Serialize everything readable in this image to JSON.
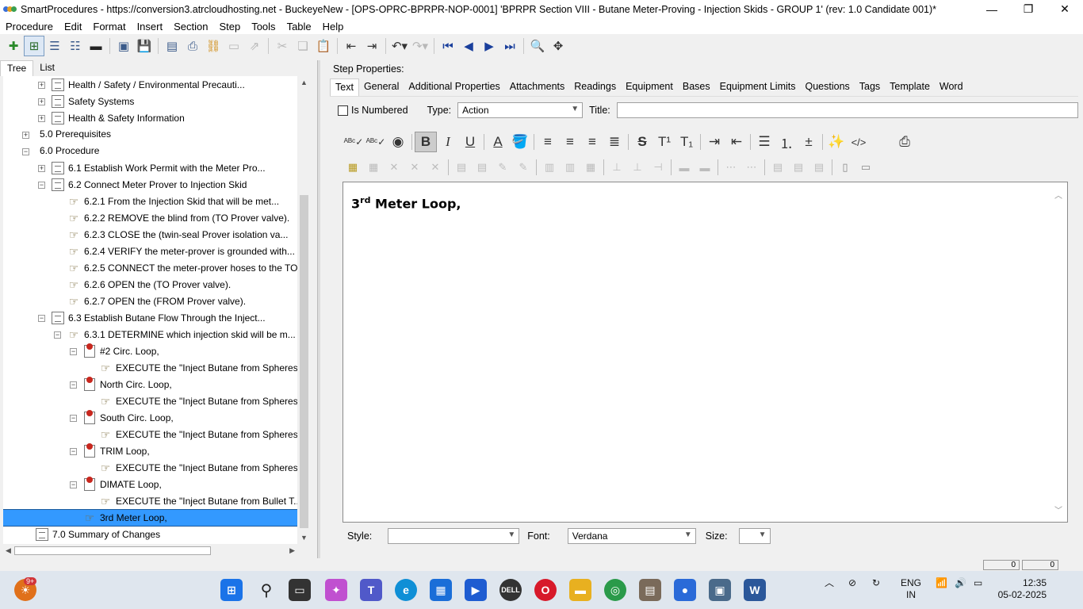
{
  "window": {
    "title": "SmartProcedures - https://conversion3.atrcloudhosting.net - BuckeyeNew - [OPS-OPRC-BPRPR-NOP-0001] 'BPRPR Section VIII - Butane Meter-Proving - Injection Skids - GROUP 1' (rev: 1.0 Candidate 001)*",
    "minimize": "—",
    "restore": "❐",
    "close": "✕"
  },
  "menu": [
    "Procedure",
    "Edit",
    "Format",
    "Insert",
    "Section",
    "Step",
    "Tools",
    "Table",
    "Help"
  ],
  "left_tabs": [
    "Tree",
    "List"
  ],
  "tree": [
    {
      "label": "Health / Safety / Environmental Precauti...",
      "indent": 2,
      "icon": "doc",
      "expander": "+"
    },
    {
      "label": "Safety Systems",
      "indent": 2,
      "icon": "doc",
      "expander": "+"
    },
    {
      "label": "Health & Safety Information",
      "indent": 2,
      "icon": "doc",
      "expander": "+"
    },
    {
      "label": "5.0 Prerequisites",
      "indent": 1,
      "icon": "none",
      "expander": "+"
    },
    {
      "label": "6.0 Procedure",
      "indent": 1,
      "icon": "none",
      "expander": "−"
    },
    {
      "label": "6.1 Establish Work Permit with the Meter Pro...",
      "indent": 2,
      "icon": "doc",
      "expander": "+"
    },
    {
      "label": "6.2 Connect Meter Prover to Injection Skid",
      "indent": 2,
      "icon": "doc",
      "expander": "−"
    },
    {
      "label": "6.2.1 From the Injection Skid that will be met...",
      "indent": 3,
      "icon": "hand",
      "expander": ""
    },
    {
      "label": "6.2.2 REMOVE the blind from (TO Prover valve).",
      "indent": 3,
      "icon": "hand",
      "expander": ""
    },
    {
      "label": "6.2.3 CLOSE the (twin-seal Prover isolation va...",
      "indent": 3,
      "icon": "hand",
      "expander": ""
    },
    {
      "label": "6.2.4 VERIFY the meter-prover is grounded with...",
      "indent": 3,
      "icon": "hand",
      "expander": ""
    },
    {
      "label": "6.2.5 CONNECT the meter-prover hoses to the TO...",
      "indent": 3,
      "icon": "hand",
      "expander": ""
    },
    {
      "label": "6.2.6 OPEN the (TO Prover valve).",
      "indent": 3,
      "icon": "hand",
      "expander": ""
    },
    {
      "label": "6.2.7 OPEN the (FROM Prover valve).",
      "indent": 3,
      "icon": "hand",
      "expander": ""
    },
    {
      "label": "6.3 Establish Butane Flow Through the Inject...",
      "indent": 2,
      "icon": "doc",
      "expander": "−"
    },
    {
      "label": "6.3.1 DETERMINE which injection skid will be m...",
      "indent": 3,
      "icon": "hand",
      "expander": "−"
    },
    {
      "label": "#2 Circ. Loop,",
      "indent": 4,
      "icon": "pin",
      "expander": "−"
    },
    {
      "label": "EXECUTE the \"Inject Butane from Spheres...",
      "indent": 5,
      "icon": "hand",
      "expander": ""
    },
    {
      "label": "North Circ. Loop,",
      "indent": 4,
      "icon": "pin",
      "expander": "−"
    },
    {
      "label": "EXECUTE the \"Inject Butane from Spheres...",
      "indent": 5,
      "icon": "hand",
      "expander": ""
    },
    {
      "label": "South Circ. Loop,",
      "indent": 4,
      "icon": "pin",
      "expander": "−"
    },
    {
      "label": "EXECUTE the \"Inject Butane from Spheres...",
      "indent": 5,
      "icon": "hand",
      "expander": ""
    },
    {
      "label": "TRIM Loop,",
      "indent": 4,
      "icon": "pin",
      "expander": "−"
    },
    {
      "label": "EXECUTE the \"Inject Butane from Spheres...",
      "indent": 5,
      "icon": "hand",
      "expander": ""
    },
    {
      "label": "DIMATE Loop,",
      "indent": 4,
      "icon": "pin",
      "expander": "−"
    },
    {
      "label": "EXECUTE the \"Inject Butane from Bullet T...",
      "indent": 5,
      "icon": "hand",
      "expander": ""
    },
    {
      "label": "3rd Meter Loop,",
      "indent": 4,
      "icon": "hand",
      "expander": "",
      "selected": true
    },
    {
      "label": "7.0 Summary of Changes",
      "indent": 1,
      "icon": "doc",
      "expander": ""
    }
  ],
  "step_props": {
    "header": "Step Properties:",
    "tabs": [
      "Text",
      "General",
      "Additional Properties",
      "Attachments",
      "Readings",
      "Equipment",
      "Bases",
      "Equipment Limits",
      "Questions",
      "Tags",
      "Template",
      "Word"
    ],
    "is_numbered_label": "Is Numbered",
    "type_label": "Type:",
    "type_value": "Action",
    "title_label": "Title:",
    "title_value": "",
    "editor_text_main": "3",
    "editor_text_sup": "rd",
    "editor_text_rest": " Meter Loop,",
    "style_label": "Style:",
    "style_value": "",
    "font_label": "Font:",
    "font_value": "Verdana",
    "size_label": "Size:",
    "size_value": ""
  },
  "status": {
    "field1": "0",
    "field2": "0"
  },
  "taskbar": {
    "badge": "9+",
    "lang": "ENG",
    "region": "IN",
    "time": "12:35",
    "date": "05-02-2025"
  }
}
